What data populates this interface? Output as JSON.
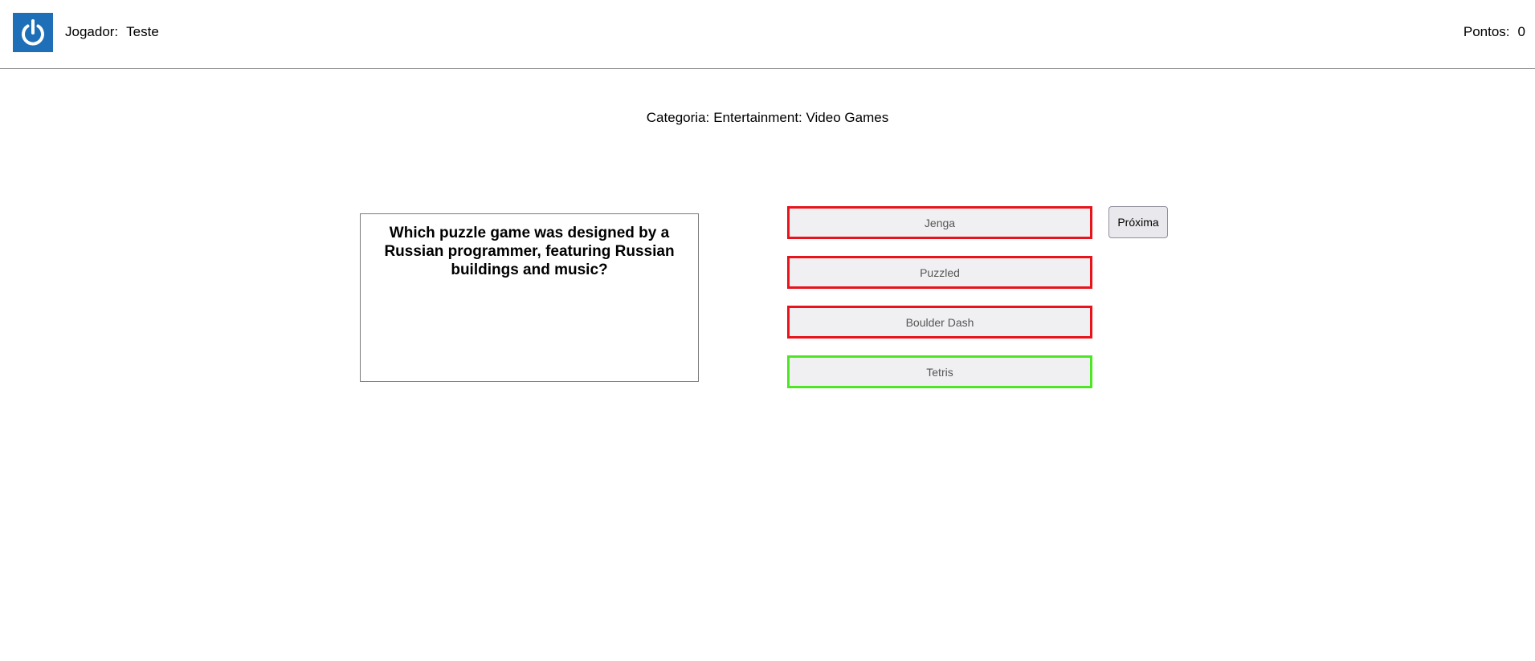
{
  "header": {
    "logo_icon": "power-icon",
    "logo_color": "#1e6fb8",
    "player_label": "Jogador:",
    "player_name": "Teste",
    "points_label": "Pontos:",
    "points_value": "0"
  },
  "category": {
    "label": "Categoria:",
    "value": "Entertainment: Video Games"
  },
  "question": {
    "text": "Which puzzle game was designed by a Russian programmer, featuring Russian buildings and music?"
  },
  "answers": [
    {
      "label": "Jenga",
      "status": "wrong"
    },
    {
      "label": "Puzzled",
      "status": "wrong"
    },
    {
      "label": "Boulder Dash",
      "status": "wrong"
    },
    {
      "label": "Tetris",
      "status": "correct"
    }
  ],
  "colors": {
    "wrong": "#e8131b",
    "correct": "#4ee524"
  },
  "next_button": {
    "label": "Próxima"
  }
}
